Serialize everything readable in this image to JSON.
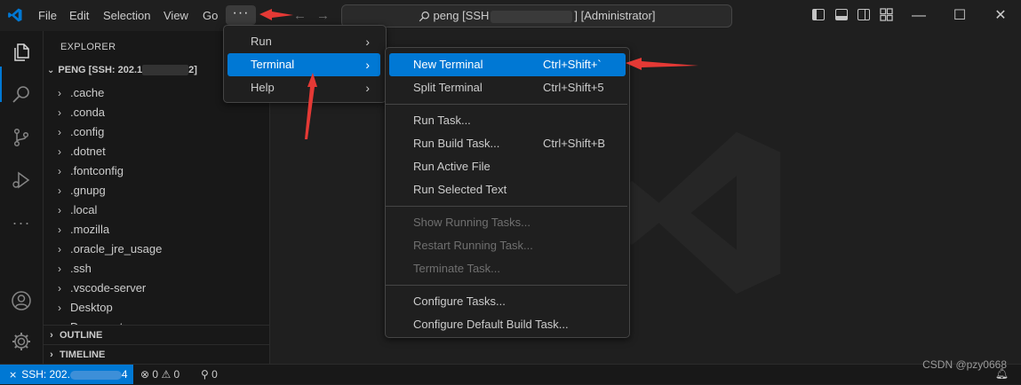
{
  "titlebar": {
    "menus": [
      "File",
      "Edit",
      "Selection",
      "View",
      "Go"
    ],
    "more_label": "···",
    "back_arrow": "←",
    "forward_arrow": "→",
    "command_center_prefix": "peng [SSH",
    "command_center_suffix": "] [Administrator]"
  },
  "window_controls": {
    "minimize": "—",
    "maximize": "☐",
    "close": "✕"
  },
  "sidebar": {
    "title": "EXPLORER",
    "folder_prefix": "PENG [SSH: 202.1",
    "folder_suffix": "2]",
    "items": [
      ".cache",
      ".conda",
      ".config",
      ".dotnet",
      ".fontconfig",
      ".gnupg",
      ".local",
      ".mozilla",
      ".oracle_jre_usage",
      ".ssh",
      ".vscode-server",
      "Desktop",
      "Documents"
    ],
    "outline_label": "OUTLINE",
    "timeline_label": "TIMELINE"
  },
  "menu_level1": {
    "items": [
      "Run",
      "Terminal",
      "Help"
    ],
    "selected": "Terminal"
  },
  "terminal_menu": {
    "groups": [
      [
        {
          "label": "New Terminal",
          "shortcut": "Ctrl+Shift+`"
        },
        {
          "label": "Split Terminal",
          "shortcut": "Ctrl+Shift+5"
        }
      ],
      [
        {
          "label": "Run Task...",
          "shortcut": ""
        },
        {
          "label": "Run Build Task...",
          "shortcut": "Ctrl+Shift+B"
        },
        {
          "label": "Run Active File",
          "shortcut": ""
        },
        {
          "label": "Run Selected Text",
          "shortcut": ""
        }
      ],
      [
        {
          "label": "Show Running Tasks...",
          "shortcut": ""
        },
        {
          "label": "Restart Running Task...",
          "shortcut": ""
        },
        {
          "label": "Terminate Task...",
          "shortcut": ""
        }
      ],
      [
        {
          "label": "Configure Tasks...",
          "shortcut": ""
        },
        {
          "label": "Configure Default Build Task...",
          "shortcut": ""
        }
      ]
    ],
    "highlighted": "New Terminal"
  },
  "statusbar": {
    "remote_prefix": "SSH: 202.",
    "remote_suffix": "4",
    "errors": "0",
    "warnings": "0",
    "ports": "0"
  },
  "watermark": "CSDN @pzy0668",
  "colors": {
    "accent": "#0078d4",
    "annotation": "#e53935"
  }
}
